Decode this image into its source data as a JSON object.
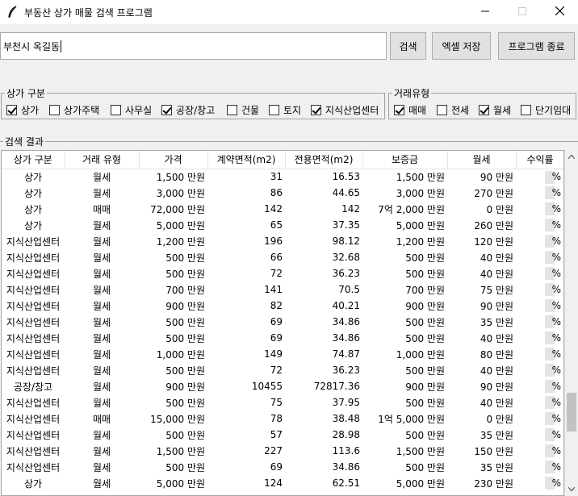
{
  "window": {
    "title": "부동산 상가 매물 검색 프로그램"
  },
  "search": {
    "value": "부천시 옥길동",
    "search_label": "검색",
    "excel_label": "엑셀 저장",
    "quit_label": "프로그램 종료"
  },
  "shop_type": {
    "legend": "상가 구분",
    "options": [
      {
        "label": "상가",
        "checked": true
      },
      {
        "label": "상가주택",
        "checked": false
      },
      {
        "label": "사무실",
        "checked": false
      },
      {
        "label": "공장/창고",
        "checked": true
      },
      {
        "label": "건물",
        "checked": false
      },
      {
        "label": "토지",
        "checked": false
      },
      {
        "label": "지식산업센터",
        "checked": true
      }
    ]
  },
  "deal_type": {
    "legend": "거래유형",
    "options": [
      {
        "label": "매매",
        "checked": true
      },
      {
        "label": "전세",
        "checked": false
      },
      {
        "label": "월세",
        "checked": true
      },
      {
        "label": "단기임대",
        "checked": false
      }
    ]
  },
  "results": {
    "legend": "검색 결과",
    "headers": [
      "상가 구분",
      "거래 유형",
      "가격",
      "계약면적(m2)",
      "전용면적(m2)",
      "보증금",
      "월세",
      "수익률"
    ],
    "rows": [
      [
        "상가",
        "월세",
        "1,500 만원",
        "31",
        "16.53",
        "1,500 만원",
        "90 만원",
        "%"
      ],
      [
        "상가",
        "월세",
        "3,000 만원",
        "86",
        "44.65",
        "3,000 만원",
        "270 만원",
        "%"
      ],
      [
        "상가",
        "매매",
        "72,000 만원",
        "142",
        "142",
        "7억 2,000 만원",
        "0 만원",
        "%"
      ],
      [
        "상가",
        "월세",
        "5,000 만원",
        "65",
        "37.35",
        "5,000 만원",
        "260 만원",
        "%"
      ],
      [
        "지식산업센터",
        "월세",
        "1,200 만원",
        "196",
        "98.12",
        "1,200 만원",
        "120 만원",
        "%"
      ],
      [
        "지식산업센터",
        "월세",
        "500 만원",
        "66",
        "32.68",
        "500 만원",
        "40 만원",
        "%"
      ],
      [
        "지식산업센터",
        "월세",
        "500 만원",
        "72",
        "36.23",
        "500 만원",
        "40 만원",
        "%"
      ],
      [
        "지식산업센터",
        "월세",
        "700 만원",
        "141",
        "70.5",
        "700 만원",
        "75 만원",
        "%"
      ],
      [
        "지식산업센터",
        "월세",
        "900 만원",
        "82",
        "40.21",
        "900 만원",
        "90 만원",
        "%"
      ],
      [
        "지식산업센터",
        "월세",
        "500 만원",
        "69",
        "34.86",
        "500 만원",
        "35 만원",
        "%"
      ],
      [
        "지식산업센터",
        "월세",
        "500 만원",
        "69",
        "34.86",
        "500 만원",
        "40 만원",
        "%"
      ],
      [
        "지식산업센터",
        "월세",
        "1,000 만원",
        "149",
        "74.87",
        "1,000 만원",
        "80 만원",
        "%"
      ],
      [
        "지식산업센터",
        "월세",
        "500 만원",
        "72",
        "36.23",
        "500 만원",
        "40 만원",
        "%"
      ],
      [
        "공장/창고",
        "월세",
        "900 만원",
        "10455",
        "72817.36",
        "900 만원",
        "90 만원",
        "%"
      ],
      [
        "지식산업센터",
        "월세",
        "500 만원",
        "75",
        "37.95",
        "500 만원",
        "40 만원",
        "%"
      ],
      [
        "지식산업센터",
        "매매",
        "15,000 만원",
        "78",
        "38.48",
        "1억 5,000 만원",
        "0 만원",
        "%"
      ],
      [
        "지식산업센터",
        "월세",
        "500 만원",
        "57",
        "28.98",
        "500 만원",
        "35 만원",
        "%"
      ],
      [
        "지식산업센터",
        "월세",
        "1,500 만원",
        "227",
        "113.6",
        "1,500 만원",
        "150 만원",
        "%"
      ],
      [
        "지식산업센터",
        "월세",
        "500 만원",
        "69",
        "34.86",
        "500 만원",
        "35 만원",
        "%"
      ],
      [
        "상가",
        "월세",
        "5,000 만원",
        "124",
        "62.51",
        "5,000 만원",
        "230 만원",
        "%"
      ]
    ]
  },
  "icons": {
    "app": "feather-icon",
    "minimize": "minimize-icon",
    "maximize": "maximize-icon",
    "close": "close-icon"
  }
}
